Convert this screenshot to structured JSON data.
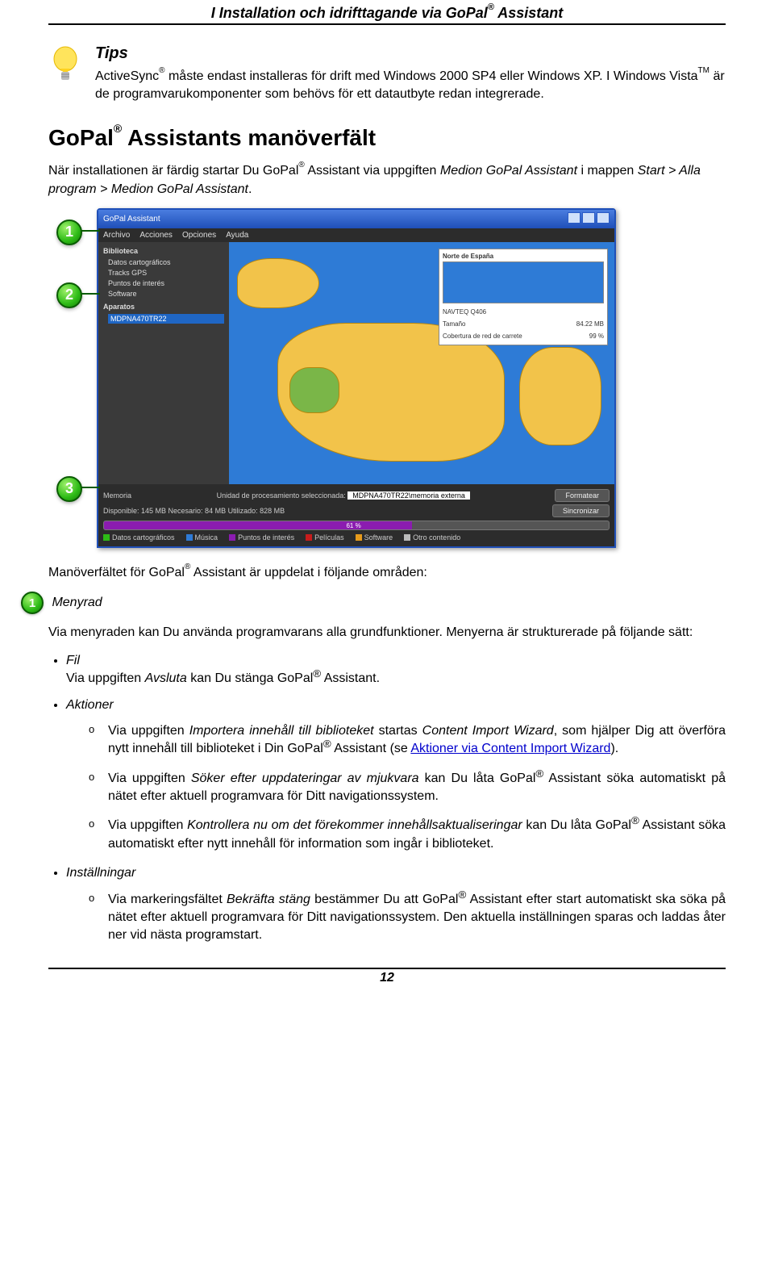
{
  "header": {
    "title_pre": "I Installation och idrifttagande via GoPal",
    "title_post": " Assistant"
  },
  "tips": {
    "title": "Tips",
    "body_pre": "ActiveSync",
    "body_mid1": " måste endast installeras för drift med Windows 2000 SP4 eller Windows XP. I Windows Vista",
    "body_tm": "TM",
    "body_post": " är de programvarukomponenter som behövs för ett datautbyte redan integrerade."
  },
  "section": {
    "title_pre": "GoPal",
    "title_post": " Assistants manöverfält",
    "intro_1": "När installationen är färdig startar Du GoPal",
    "intro_2": " Assistant via uppgiften ",
    "intro_italic": "Medion GoPal Assistant",
    "intro_3": " i mappen ",
    "intro_italic2": "Start > Alla program > Medion GoPal Assistant",
    "intro_4": "."
  },
  "callouts": {
    "c1": "1",
    "c2": "2",
    "c3": "3"
  },
  "screenshot": {
    "window_title": "GoPal Assistant",
    "menu": {
      "m1": "Archivo",
      "m2": "Acciones",
      "m3": "Opciones",
      "m4": "Ayuda"
    },
    "side": {
      "title": "Biblioteca",
      "item1": "Datos cartográficos",
      "item2": "Tracks GPS",
      "item3": "Puntos de interés",
      "item4": "Software",
      "title2": "Aparatos",
      "item5": "MDPNA470TR22"
    },
    "inset": {
      "title": "Norte de España",
      "row1_label": "NAVTEQ Q406",
      "row2_label": "Tamaño",
      "row2_value": "84.22 MB",
      "row3_label": "Cobertura de red de carrete",
      "row3_value": "99 %"
    },
    "status": {
      "mem_label": "Memoria",
      "mem_label2": "Unidad de procesamiento seleccionada:",
      "mem_value": "MDPNA470TR22\\memoria externa",
      "btn1": "Formatear",
      "disp": "Disponible: 145 MB  Necesario: 84 MB  Utilizado: 828 MB",
      "btn2": "Sincronizar",
      "pct": "61 %",
      "legend1": "Datos cartográficos",
      "legend2": "Música",
      "legend3": "Puntos de interés",
      "legend4": "Películas",
      "legend5": "Software",
      "legend6": "Otro contenido"
    }
  },
  "area_intro": {
    "pre": "Manöverfältet för GoPal",
    "post": " Assistant är uppdelat i följande områden:"
  },
  "area1": {
    "badge": "1",
    "title": "Menyrad",
    "para": "Via menyraden kan Du använda programvarans alla grundfunktioner. Menyerna är strukturerade på följande sätt:"
  },
  "bullets": {
    "fil_title": "Fil",
    "fil_body_pre": "Via uppgiften ",
    "fil_body_italic": "Avsluta",
    "fil_body_mid": " kan Du stänga GoPal",
    "fil_body_post": " Assistant.",
    "aktioner_title": "Aktioner",
    "akt_sub1_pre": "Via uppgiften ",
    "akt_sub1_italic1": "Importera innehåll till biblioteket",
    "akt_sub1_mid1": " startas ",
    "akt_sub1_italic2": "Content Import Wizard",
    "akt_sub1_mid2": ", som hjälper Dig att överföra nytt innehåll till biblioteket i Din GoPal",
    "akt_sub1_post1": " Assistant (se ",
    "akt_sub1_link": "Aktioner via Content Import Wizard",
    "akt_sub1_post2": ").",
    "akt_sub2_pre": "Via uppgiften ",
    "akt_sub2_italic": "Söker efter uppdateringar av mjukvara",
    "akt_sub2_mid": " kan Du låta GoPal",
    "akt_sub2_post": " Assistant söka automatiskt på nätet efter aktuell programvara för Ditt navigationssystem.",
    "akt_sub3_pre": "Via uppgiften ",
    "akt_sub3_italic": "Kontrollera nu om det förekommer innehållsaktualiseringar",
    "akt_sub3_mid": " kan Du låta GoPal",
    "akt_sub3_post": " Assistant söka automatiskt efter nytt innehåll för information som ingår i biblioteket.",
    "inst_title": "Inställningar",
    "inst_sub1_pre": "Via markeringsfältet ",
    "inst_sub1_italic": "Bekräfta stäng",
    "inst_sub1_mid": " bestämmer Du att GoPal",
    "inst_sub1_post": " Assistant efter start automatiskt ska söka på nätet efter aktuell programvara för Ditt navigationssystem. Den aktuella inställningen sparas och laddas åter ner vid nästa programstart."
  },
  "page_number": "12"
}
